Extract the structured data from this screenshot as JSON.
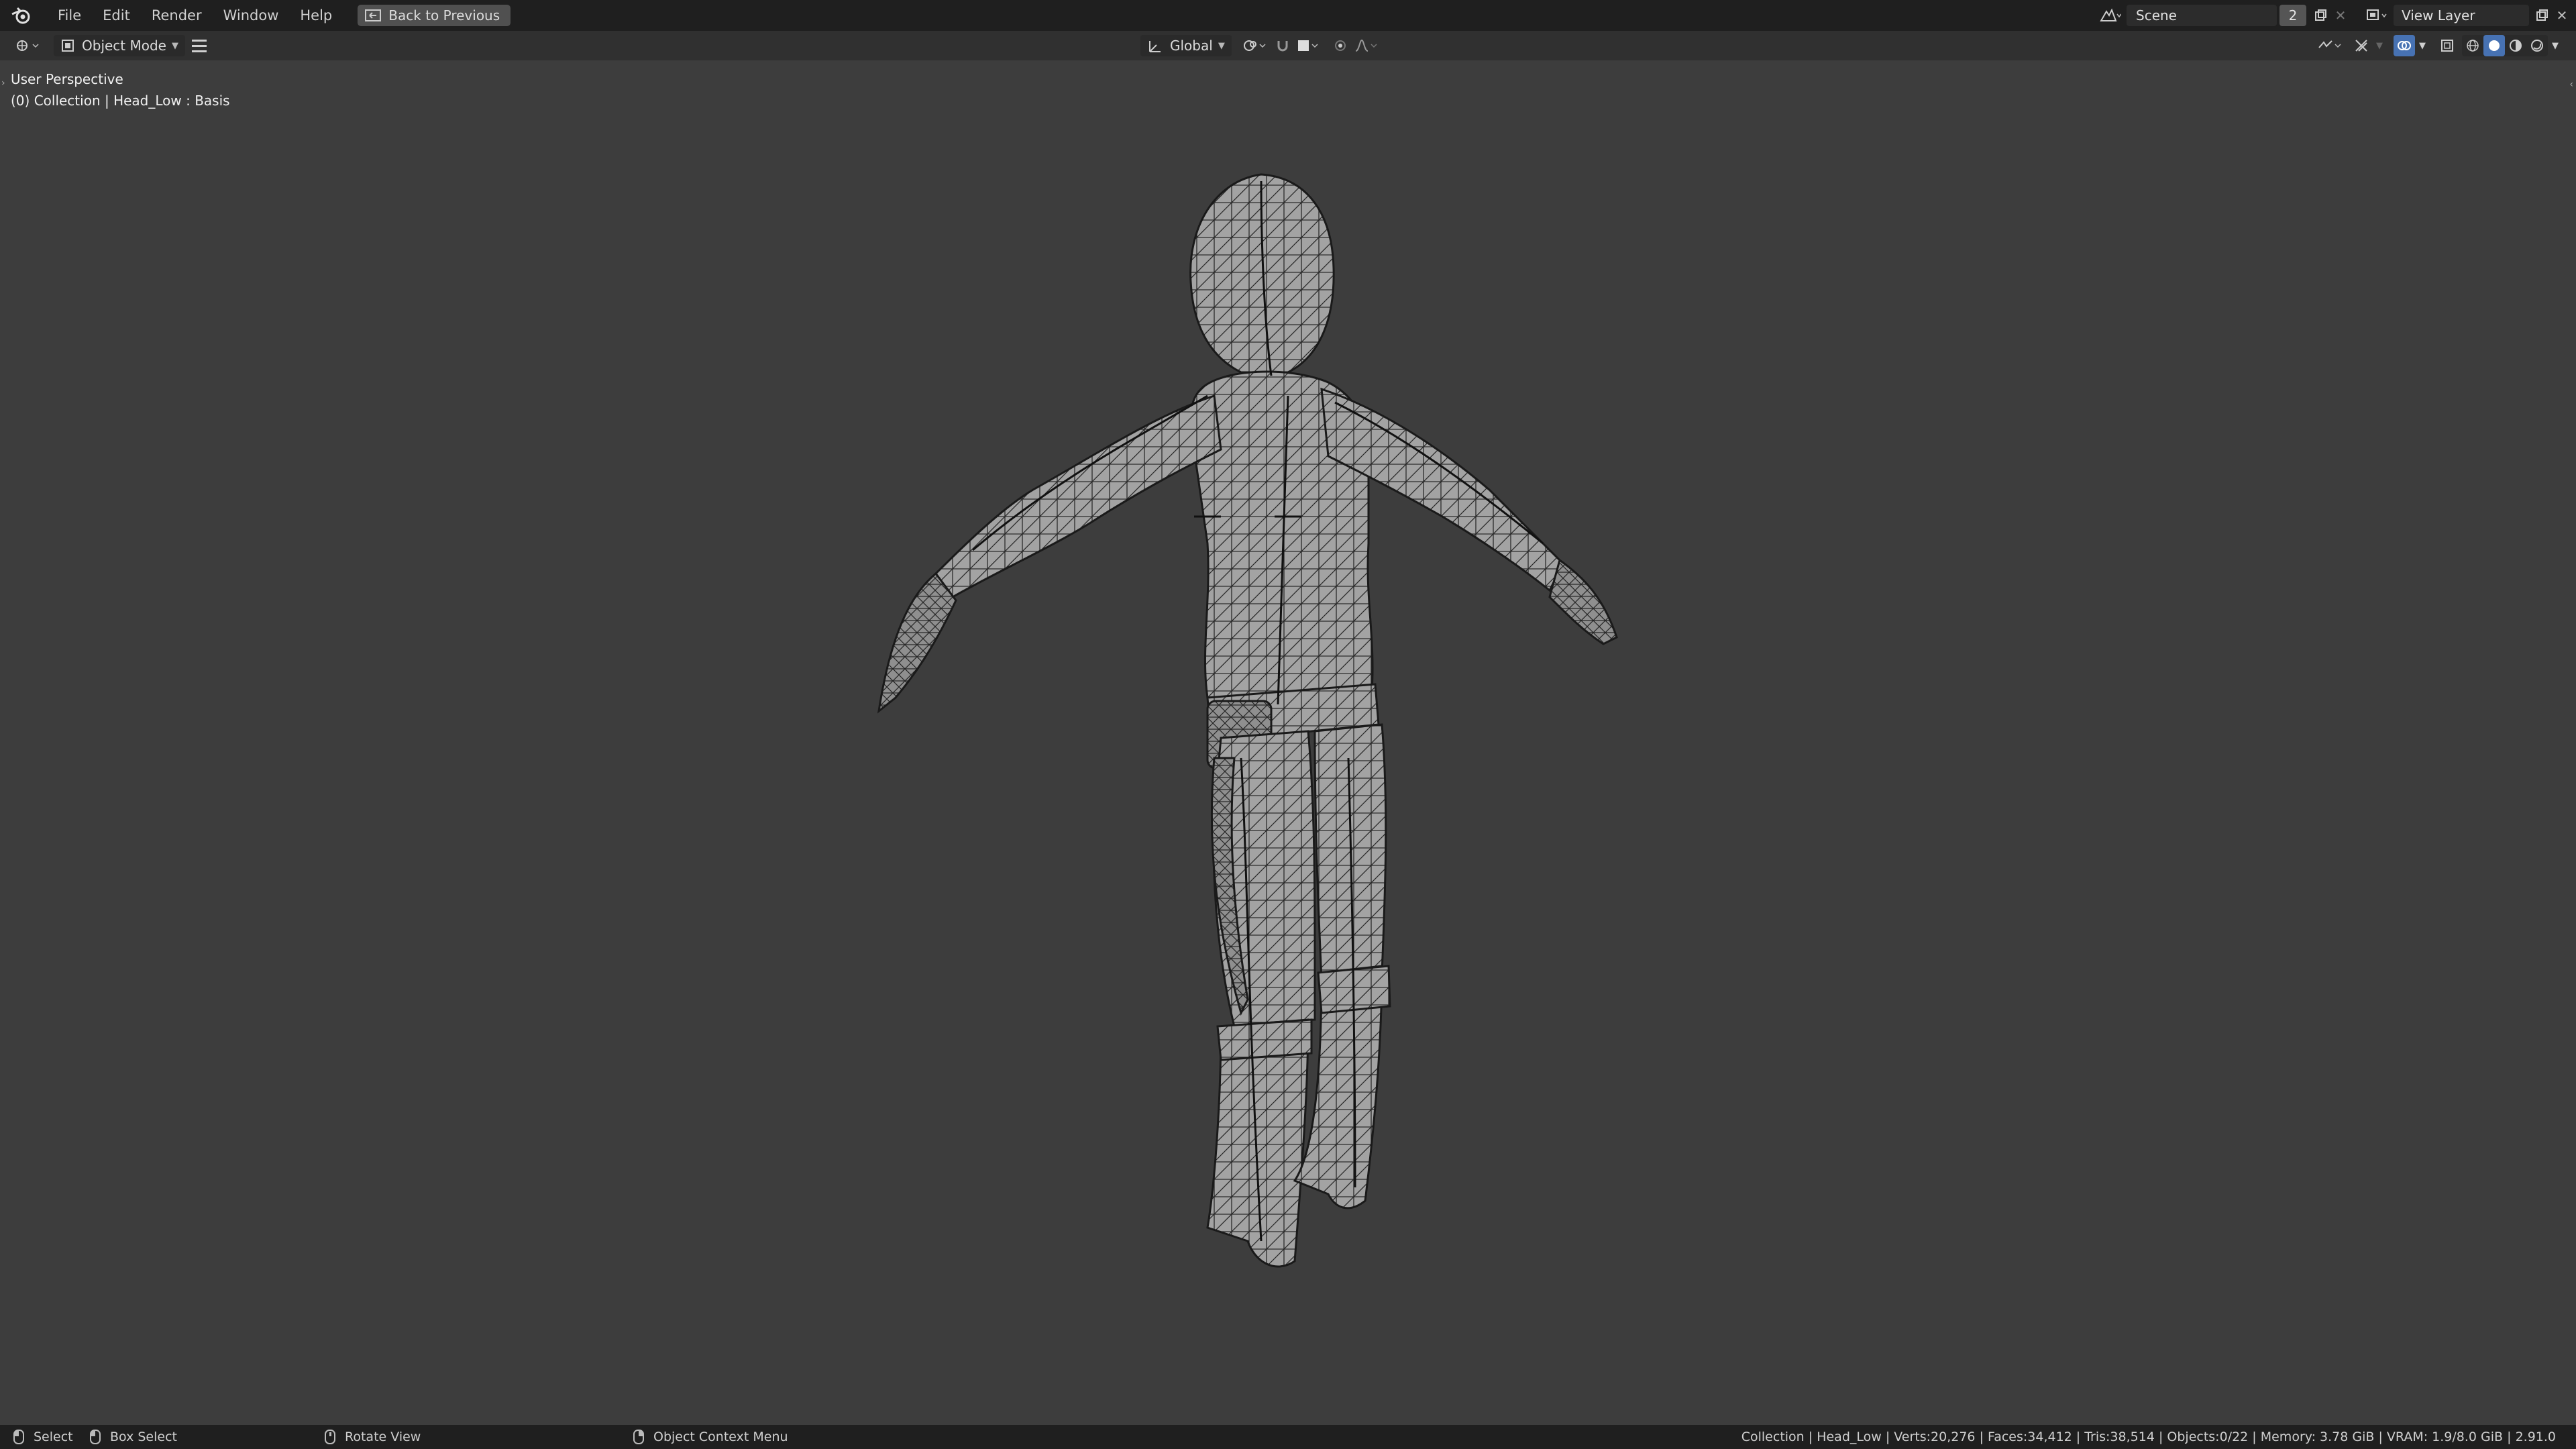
{
  "menu": {
    "logo_icon": "blender-logo-icon",
    "items": [
      "File",
      "Edit",
      "Render",
      "Window",
      "Help"
    ],
    "back_button": "Back to Previous"
  },
  "scene": {
    "name": "Scene",
    "user_count": "2",
    "view_layer": "View Layer"
  },
  "header": {
    "mode": "Object Mode",
    "orientation": "Global"
  },
  "viewport": {
    "perspective": "User Perspective",
    "collection_info": "(0) Collection | Head_Low : Basis"
  },
  "status": {
    "select": "Select",
    "box_select": "Box Select",
    "rotate_view": "Rotate View",
    "context_menu": "Object Context Menu",
    "stats": "Collection | Head_Low | Verts:20,276 | Faces:34,412 | Tris:38,514 | Objects:0/22 | Memory: 3.78 GiB | VRAM: 1.9/8.0 GiB | 2.91.0"
  },
  "colors": {
    "viewport_bg": "#3d3d3d",
    "topbar_bg": "#1f1f1f",
    "header_bg": "#303030",
    "accent": "#4772b3",
    "model_fill": "#9a9a9a",
    "wire": "#1a1a1a"
  }
}
